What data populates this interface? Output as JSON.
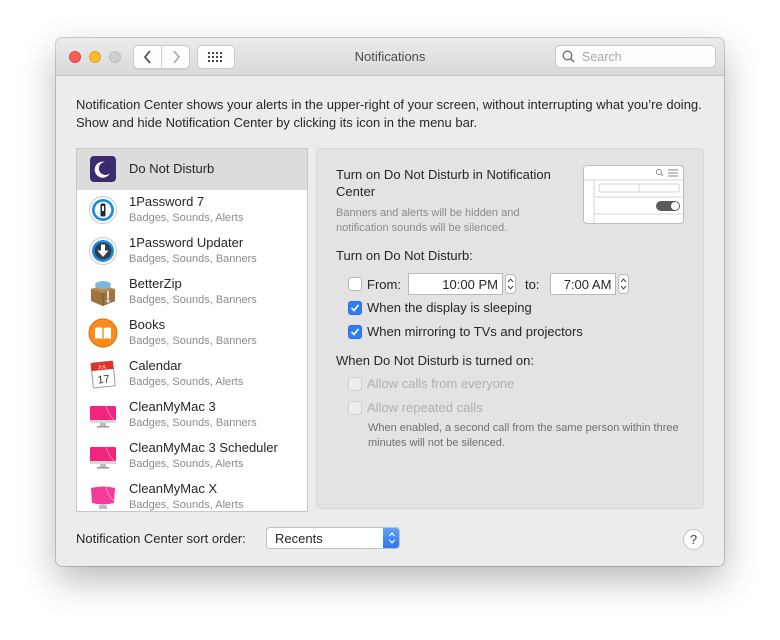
{
  "window": {
    "title": "Notifications",
    "search_placeholder": "Search",
    "intro_text": "Notification Center shows your alerts in the upper-right of your screen, without interrupting what you’re doing. Show and hide Notification Center by clicking its icon in the menu bar."
  },
  "toolbar": {
    "back_icon": "chevron-left-icon",
    "forward_icon": "chevron-right-icon",
    "show_all_icon": "grid-icon"
  },
  "apps": [
    {
      "name": "Do Not Disturb",
      "subtitle": "",
      "icon": "moon-icon",
      "selected": true
    },
    {
      "name": "1Password 7",
      "subtitle": "Badges, Sounds, Alerts",
      "icon": "1password-icon"
    },
    {
      "name": "1Password Updater",
      "subtitle": "Badges, Sounds, Banners",
      "icon": "1password-updater-icon"
    },
    {
      "name": "BetterZip",
      "subtitle": "Badges, Sounds, Banners",
      "icon": "betterzip-icon"
    },
    {
      "name": "Books",
      "subtitle": "Badges, Sounds, Banners",
      "icon": "books-icon"
    },
    {
      "name": "Calendar",
      "subtitle": "Badges, Sounds, Alerts",
      "icon": "calendar-icon",
      "calendar_month": "JUL",
      "calendar_day": "17"
    },
    {
      "name": "CleanMyMac 3",
      "subtitle": "Badges, Sounds, Banners",
      "icon": "cleanmymac-icon"
    },
    {
      "name": "CleanMyMac 3 Scheduler",
      "subtitle": "Badges, Sounds, Alerts",
      "icon": "cleanmymac-icon"
    },
    {
      "name": "CleanMyMac X",
      "subtitle": "Badges, Sounds, Alerts",
      "icon": "cleanmymac-x-icon"
    }
  ],
  "detail": {
    "title": "Turn on Do Not Disturb in Notification Center",
    "description": "Banners and alerts will be hidden and notification sounds will be silenced.",
    "turn_on_label": "Turn on Do Not Disturb:",
    "from_label": "From:",
    "from_checked": false,
    "from_time": "10:00 PM",
    "to_label": "to:",
    "to_time": "7:00 AM",
    "display_sleeping_label": "When the display is sleeping",
    "display_sleeping_checked": true,
    "mirroring_label": "When mirroring to TVs and projectors",
    "mirroring_checked": true,
    "when_on_label": "When Do Not Disturb is turned on:",
    "allow_calls_label": "Allow calls from everyone",
    "allow_calls_checked": false,
    "repeated_calls_label": "Allow repeated calls",
    "repeated_calls_checked": false,
    "repeated_note": "When enabled, a second call from the same person within three minutes will not be silenced."
  },
  "footer": {
    "sort_label": "Notification Center sort order:",
    "sort_value": "Recents",
    "help_label": "?"
  },
  "colors": {
    "accent": "#2f7cf6",
    "close": "#fc5f57",
    "minimize": "#fdbc2e",
    "zoom_disabled": "#cfcfcf",
    "dnd_icon": "#3b2a6e",
    "cleanmymac": "#f2247d"
  }
}
